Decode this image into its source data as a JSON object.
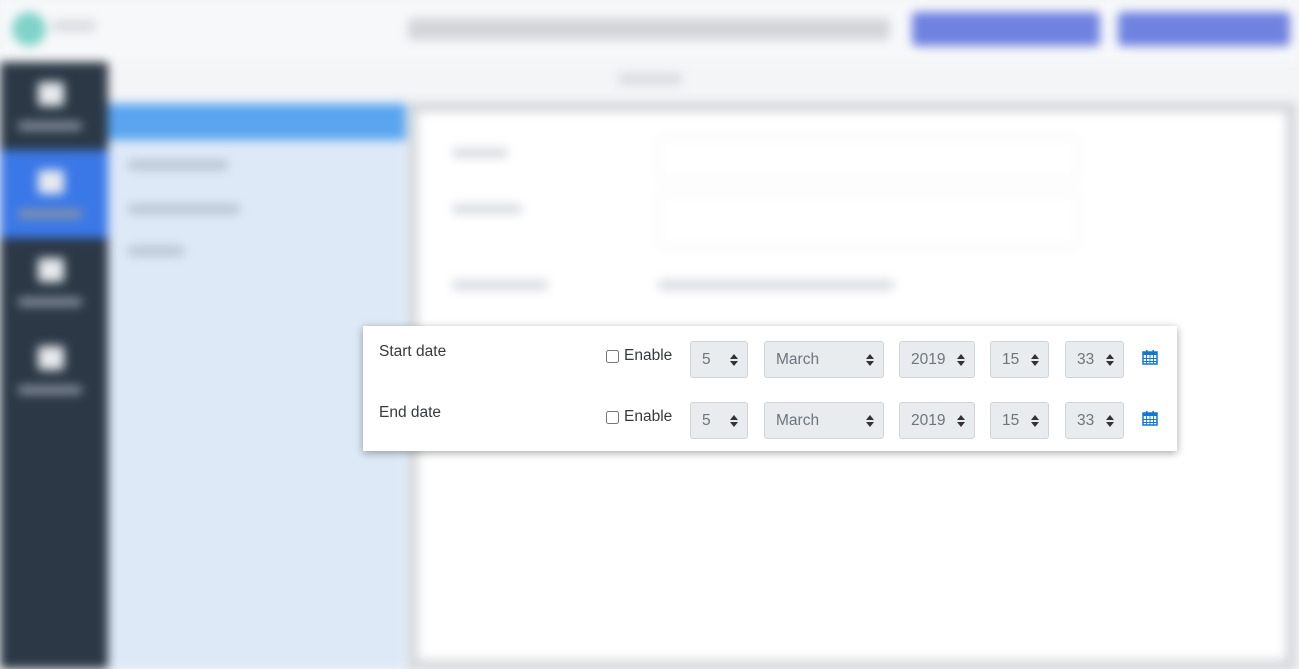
{
  "colors": {
    "accent": "#3b78e7",
    "calendar_icon": "#1177d1",
    "select_bg": "#e9ecef"
  },
  "date_rows": [
    {
      "label": "Start date",
      "enable_label": "Enable",
      "enabled": false,
      "day": "5",
      "month": "March",
      "year": "2019",
      "hour": "15",
      "minute": "33",
      "icon": "calendar-icon"
    },
    {
      "label": "End date",
      "enable_label": "Enable",
      "enabled": false,
      "day": "5",
      "month": "March",
      "year": "2019",
      "hour": "15",
      "minute": "33",
      "icon": "calendar-icon"
    }
  ]
}
